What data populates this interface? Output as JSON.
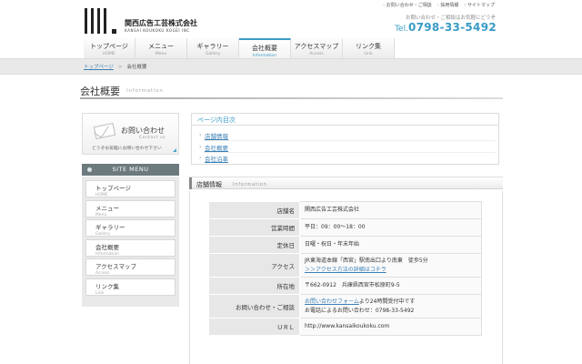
{
  "header": {
    "company_ja": "関西広告工芸株式会社",
    "company_en": "KANSAI KOUKOKU KOGEI INC",
    "top_links": [
      "お問い合わせ・ご相談",
      "採用情報",
      "サイトマップ"
    ],
    "contact_note": "お問い合わせ・ご相談はお気軽にどうぞ",
    "tel_label": "Tel.",
    "tel_number": "0798-33-5492"
  },
  "nav": [
    {
      "ja": "トップページ",
      "en": "HOME"
    },
    {
      "ja": "メニュー",
      "en": "Menu"
    },
    {
      "ja": "ギャラリー",
      "en": "Gallery"
    },
    {
      "ja": "会社概要",
      "en": "Information"
    },
    {
      "ja": "アクセスマップ",
      "en": "Access"
    },
    {
      "ja": "リンク集",
      "en": "Link"
    }
  ],
  "breadcrumb": {
    "home": "トップページ",
    "sep": ">",
    "current": "会社概要"
  },
  "page": {
    "title": "会社概要",
    "title_en": "Information"
  },
  "sidebar": {
    "inquiry_title": "お問い合わせ",
    "inquiry_en": "Contact us",
    "inquiry_note": "どうぞお気軽にお問い合わせ下さい",
    "site_menu_title": "SITE MENU",
    "items": [
      {
        "ja": "トップページ",
        "en": "HOME"
      },
      {
        "ja": "メニュー",
        "en": "Menu"
      },
      {
        "ja": "ギャラリー",
        "en": "Gallery"
      },
      {
        "ja": "会社概要",
        "en": "Information"
      },
      {
        "ja": "アクセスマップ",
        "en": "Access"
      },
      {
        "ja": "リンク集",
        "en": "Link"
      }
    ]
  },
  "toc": {
    "title": "ページ内目次",
    "links": [
      "店舗情報",
      "会社概要",
      "会社沿革"
    ]
  },
  "store": {
    "heading": "店舗情報",
    "heading_en": "Information",
    "rows": {
      "name": {
        "label": "店舗名",
        "value": "関西広告工芸株式会社"
      },
      "hours": {
        "label": "営業時間",
        "value": "平日：09：00〜18：00"
      },
      "holiday": {
        "label": "定休日",
        "value": "日曜・祝日・年末年始"
      },
      "access": {
        "label": "アクセス",
        "line1": "JR東海道本線「西宮」駅南出口より南東　徒歩5分",
        "link": "＞＞アクセス方法の詳細はコチラ"
      },
      "address": {
        "label": "所在地",
        "value": "〒662-0912　兵庫県西宮市松原町9-5"
      },
      "inquiry": {
        "label": "お問い合わせ・ご相談",
        "form_link": "お問い合わせフォーム",
        "form_rest": "より24時間受付中です",
        "phone_line": "お電話によるお問い合わせ：0798-33-5492"
      },
      "url": {
        "label": "ＵＲＬ",
        "value": "http://www.kansaikoukoku.com"
      }
    }
  }
}
